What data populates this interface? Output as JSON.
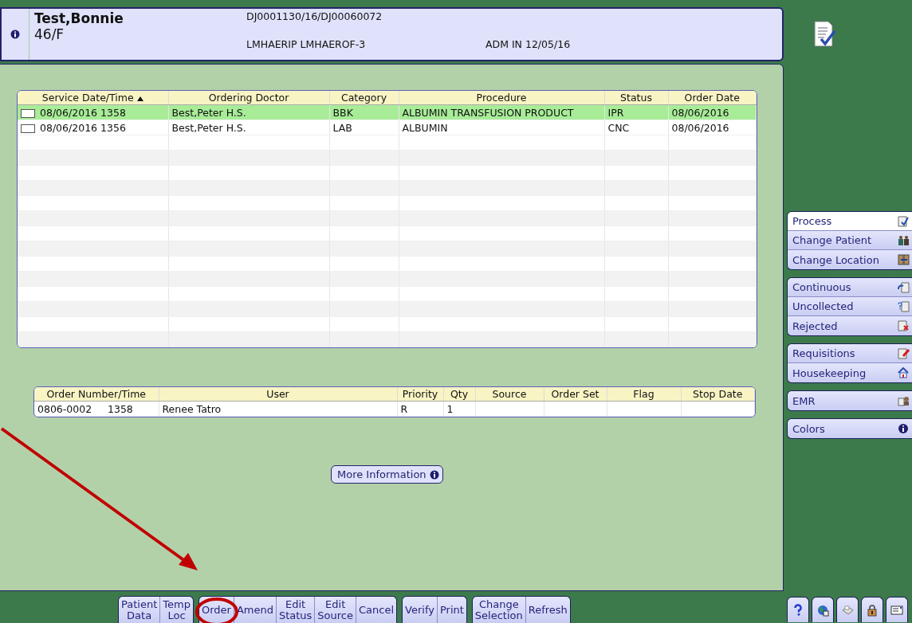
{
  "header": {
    "name": "Test,Bonnie",
    "age_sex": "46/F",
    "account": "DJ0001130/16/DJ00060072",
    "location": "LMHAERIP LMHAEROF-3",
    "admission": "ADM IN 12/05/16"
  },
  "orders_table": {
    "columns": [
      {
        "label": "Service Date/Time",
        "sorted": true
      },
      {
        "label": "Ordering Doctor",
        "sorted": false
      },
      {
        "label": "Category",
        "sorted": false
      },
      {
        "label": "Procedure",
        "sorted": false
      },
      {
        "label": "Status",
        "sorted": false
      },
      {
        "label": "Order Date",
        "sorted": false
      }
    ],
    "rows": [
      {
        "selected": true,
        "checked": false,
        "cells": [
          "08/06/2016 1358",
          "Best,Peter H.S.",
          "BBK",
          "ALBUMIN TRANSFUSION PRODUCT",
          "IPR",
          "08/06/2016"
        ]
      },
      {
        "selected": false,
        "checked": false,
        "cells": [
          "08/06/2016 1356",
          "Best,Peter H.S.",
          "LAB",
          "ALBUMIN",
          "CNC",
          "08/06/2016"
        ]
      }
    ]
  },
  "detail_table": {
    "columns": [
      "Order Number/Time",
      "User",
      "Priority",
      "Qty",
      "Source",
      "Order Set",
      "Flag",
      "Stop Date"
    ],
    "rows": [
      {
        "cells": [
          "0806-0002     1358",
          "Renee Tatro",
          "R",
          "1",
          "",
          "",
          "",
          ""
        ]
      }
    ]
  },
  "more_info_button": {
    "label": "More Information"
  },
  "side_menu": {
    "groups": [
      [
        {
          "label": "Process",
          "selected": true
        },
        {
          "label": "Change Patient",
          "selected": false
        },
        {
          "label": "Change Location",
          "selected": false
        }
      ],
      [
        {
          "label": "Continuous",
          "selected": false
        },
        {
          "label": "Uncollected",
          "selected": false
        },
        {
          "label": "Rejected",
          "selected": false
        }
      ],
      [
        {
          "label": "Requisitions",
          "selected": false
        },
        {
          "label": "Housekeeping",
          "selected": false
        }
      ],
      [
        {
          "label": "EMR",
          "selected": false
        }
      ],
      [
        {
          "label": "Colors",
          "selected": false
        }
      ]
    ]
  },
  "toolbar": {
    "groups": [
      [
        {
          "label": "Patient Data",
          "circled": false
        },
        {
          "label": "Temp Loc",
          "circled": false
        }
      ],
      [
        {
          "label": "Order",
          "circled": true
        },
        {
          "label": "Amend",
          "circled": false
        },
        {
          "label": "Edit Status",
          "circled": false
        },
        {
          "label": "Edit Source",
          "circled": false
        },
        {
          "label": "Cancel",
          "circled": false
        }
      ],
      [
        {
          "label": "Verify",
          "circled": false
        },
        {
          "label": "Print",
          "circled": false
        }
      ],
      [
        {
          "label": "Change Selection",
          "circled": false
        },
        {
          "label": "Refresh",
          "circled": false
        }
      ]
    ]
  },
  "annotation": {
    "arrow": true
  }
}
